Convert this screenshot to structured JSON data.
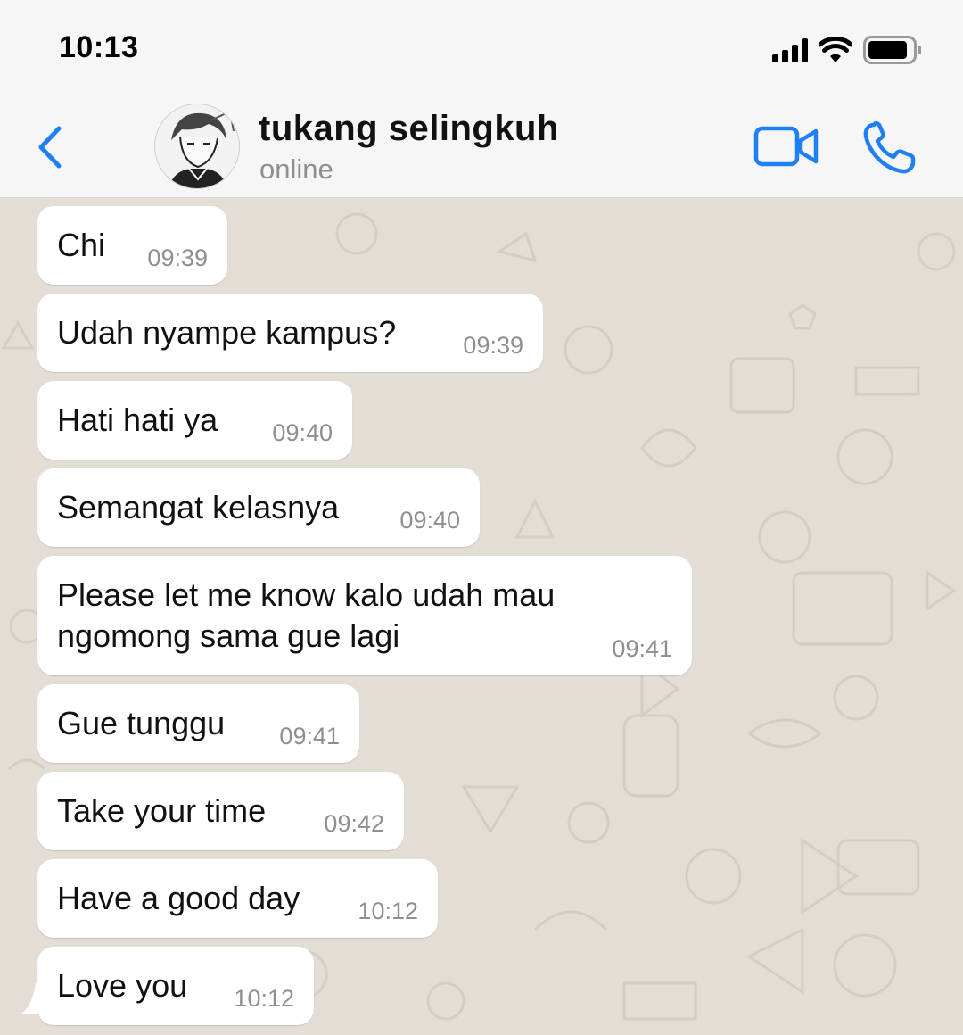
{
  "status_bar": {
    "time": "10:13",
    "icons": [
      "cellular-signal-icon",
      "wifi-icon",
      "battery-icon"
    ]
  },
  "header": {
    "contact_name": "tukang selingkuh",
    "contact_status": "online",
    "icons": [
      "chevron-left-icon",
      "video-camera-icon",
      "phone-icon"
    ],
    "accent_color": "#1f7ff5"
  },
  "chat": {
    "background_color": "#e3ddd6",
    "bubble_color": "#ffffff",
    "messages": [
      {
        "text": "Chi",
        "time": "09:39"
      },
      {
        "text": "Udah nyampe kampus?",
        "time": "09:39"
      },
      {
        "text": "Hati hati ya",
        "time": "09:40"
      },
      {
        "text": "Semangat kelasnya",
        "time": "09:40"
      },
      {
        "text": "Please let me know kalo udah mau",
        "text2": "ngomong sama gue lagi",
        "time": "09:41"
      },
      {
        "text": "Gue tunggu",
        "time": "09:41"
      },
      {
        "text": "Take your time",
        "time": "09:42"
      },
      {
        "text": "Have a good day",
        "time": "10:12"
      },
      {
        "text": "Love you",
        "time": "10:12"
      }
    ]
  }
}
